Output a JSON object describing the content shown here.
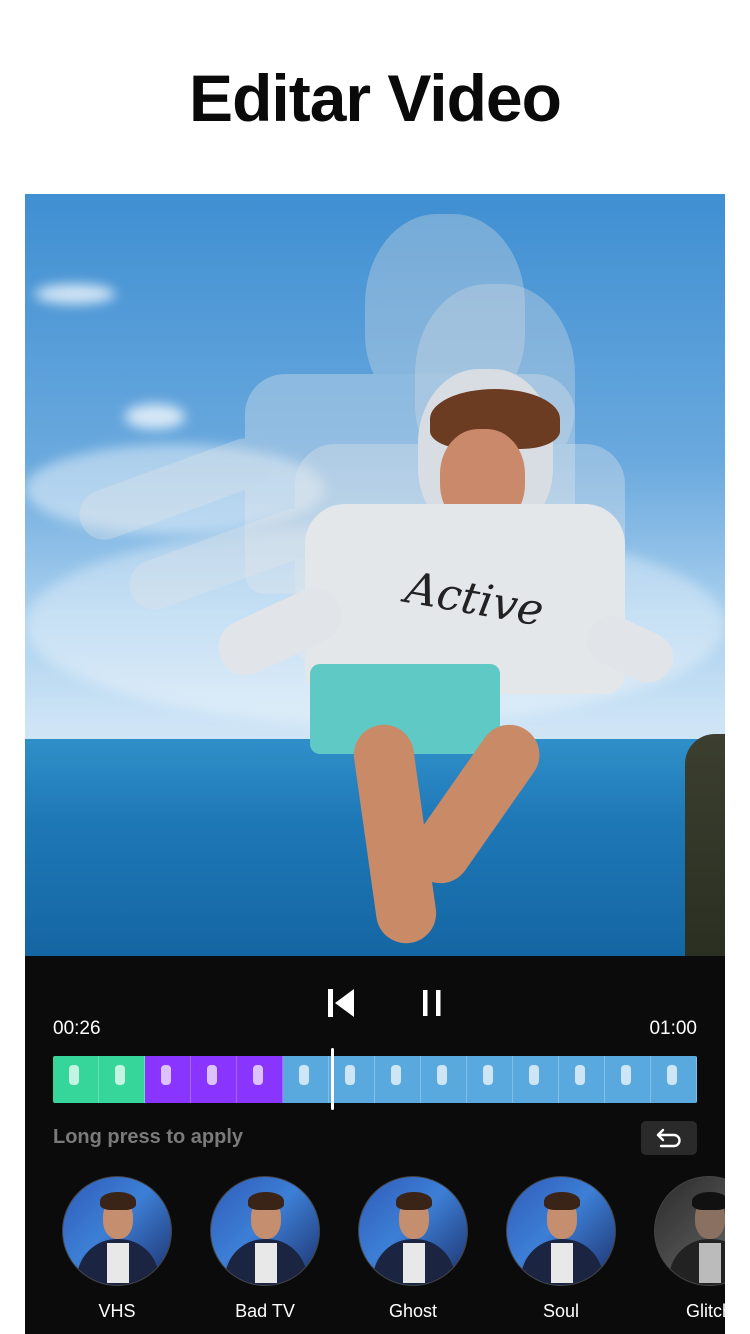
{
  "header": {
    "title": "Editar Video"
  },
  "preview": {
    "shirt_text": "Active"
  },
  "player": {
    "current_time": "00:26",
    "total_time": "01:00",
    "progress_fraction": 0.433
  },
  "timeline": {
    "segments": [
      {
        "effect": "green",
        "color": "#36d69a",
        "frames": 2
      },
      {
        "effect": "purple",
        "color": "#8a35ff",
        "frames": 3
      },
      {
        "effect": "none",
        "color": "#59a9de",
        "frames": 9
      }
    ]
  },
  "hint": "Long press to apply",
  "effects": [
    {
      "label": "VHS"
    },
    {
      "label": "Bad TV"
    },
    {
      "label": "Ghost"
    },
    {
      "label": "Soul"
    },
    {
      "label": "Glitch"
    }
  ],
  "icons": {
    "previous": "skip-previous-icon",
    "pause": "pause-icon",
    "undo": "undo-icon"
  }
}
